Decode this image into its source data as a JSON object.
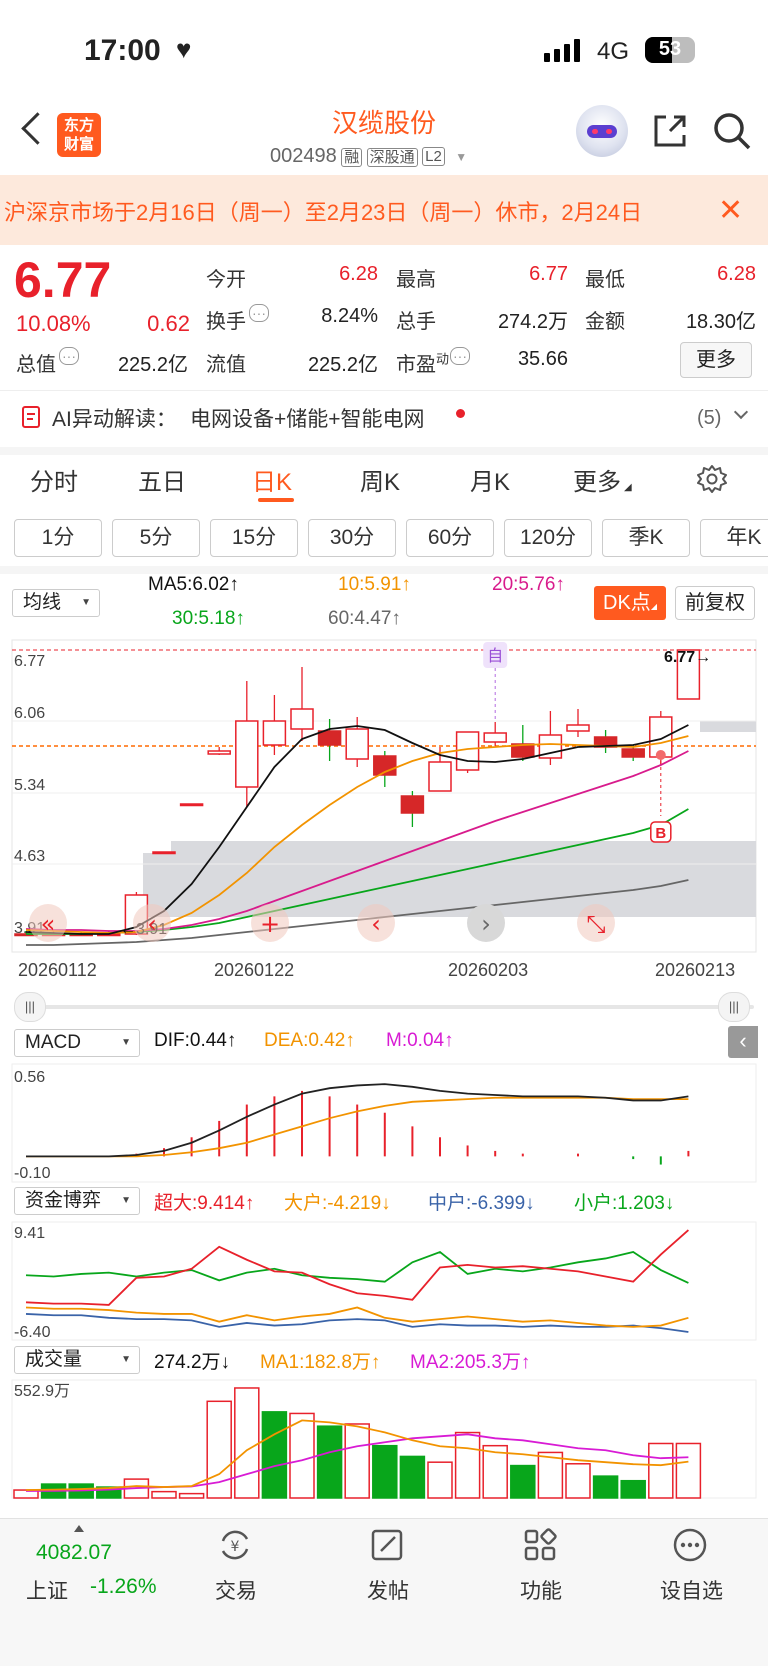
{
  "status_bar": {
    "time": "17:00",
    "network": "4G",
    "battery": "53"
  },
  "header": {
    "logo_line1": "东方",
    "logo_line2": "财富",
    "stock_name": "汉缆股份",
    "stock_code": "002498",
    "tags": [
      "融",
      "深股通",
      "L2"
    ]
  },
  "notice": {
    "text": "沪深京市场于2月16日（周一）至2月23日（周一）休市，2月24日"
  },
  "quote": {
    "price": "6.77",
    "change_pct": "10.08%",
    "change_amt": "0.62",
    "open_label": "今开",
    "open": "6.28",
    "high_label": "最高",
    "high": "6.77",
    "low_label": "最低",
    "low": "6.28",
    "turnover_label": "换手",
    "turnover": "8.24%",
    "volume_label": "总手",
    "volume": "274.2万",
    "amount_label": "金额",
    "amount": "18.30亿",
    "mktcap_label": "总值",
    "mktcap": "225.2亿",
    "float_label": "流值",
    "float": "225.2亿",
    "pe_label": "市盈",
    "pe_sup": "动",
    "pe": "35.66",
    "more": "更多"
  },
  "ai": {
    "label": "AI异动解读：",
    "text": "电网设备+储能+智能电网",
    "count": "(5)"
  },
  "tabs": [
    "分时",
    "五日",
    "日K",
    "周K",
    "月K",
    "更多"
  ],
  "active_tab": "日K",
  "periods": [
    "1分",
    "5分",
    "15分",
    "30分",
    "60分",
    "120分",
    "季K",
    "年K"
  ],
  "ma": {
    "selector": "均线",
    "ma5": "MA5:6.02↑",
    "ma10": "10:5.91↑",
    "ma20": "20:5.76↑",
    "ma30": "30:5.18↑",
    "ma60": "60:4.47↑",
    "dk": "DK点",
    "fq": "前复权"
  },
  "kline": {
    "price_labels": [
      "6.77",
      "6.06",
      "5.34",
      "4.63",
      "3.91"
    ],
    "dates": [
      "20260112",
      "20260122",
      "20260203",
      "20260213"
    ],
    "max_label": "6.77→",
    "min_label": "←3.91",
    "mark_self": "自",
    "mark_b": "B",
    "candles": [
      {
        "o": 3.93,
        "c": 3.92,
        "h": 3.96,
        "l": 3.91
      },
      {
        "o": 3.92,
        "c": 3.93,
        "h": 3.97,
        "l": 3.91
      },
      {
        "o": 3.93,
        "c": 3.92,
        "h": 3.95,
        "l": 3.91
      },
      {
        "o": 3.92,
        "c": 3.93,
        "h": 3.96,
        "l": 3.91
      },
      {
        "o": 3.93,
        "c": 4.32,
        "h": 4.35,
        "l": 3.92
      },
      {
        "o": 4.74,
        "c": 4.75,
        "h": 4.75,
        "l": 4.74
      },
      {
        "o": 5.22,
        "c": 5.23,
        "h": 5.23,
        "l": 5.22
      },
      {
        "o": 5.73,
        "c": 5.76,
        "h": 5.8,
        "l": 5.72
      },
      {
        "o": 5.4,
        "c": 6.06,
        "h": 6.46,
        "l": 5.2
      },
      {
        "o": 5.82,
        "c": 6.06,
        "h": 6.32,
        "l": 5.72
      },
      {
        "o": 5.98,
        "c": 6.18,
        "h": 6.6,
        "l": 5.86
      },
      {
        "o": 5.96,
        "c": 5.82,
        "h": 6.08,
        "l": 5.66
      },
      {
        "o": 5.68,
        "c": 5.98,
        "h": 6.1,
        "l": 5.6
      },
      {
        "o": 5.71,
        "c": 5.52,
        "h": 5.76,
        "l": 5.4
      },
      {
        "o": 5.31,
        "c": 5.14,
        "h": 5.36,
        "l": 5.0
      },
      {
        "o": 5.36,
        "c": 5.65,
        "h": 5.8,
        "l": 5.36
      },
      {
        "o": 5.57,
        "c": 5.95,
        "h": 5.95,
        "l": 5.54
      },
      {
        "o": 5.85,
        "c": 5.94,
        "h": 6.05,
        "l": 5.81
      },
      {
        "o": 5.83,
        "c": 5.7,
        "h": 6.02,
        "l": 5.66
      },
      {
        "o": 5.69,
        "c": 5.92,
        "h": 6.16,
        "l": 5.62
      },
      {
        "o": 5.96,
        "c": 6.02,
        "h": 6.18,
        "l": 5.9
      },
      {
        "o": 5.9,
        "c": 5.8,
        "h": 5.97,
        "l": 5.74
      },
      {
        "o": 5.78,
        "c": 5.7,
        "h": 5.82,
        "l": 5.66
      },
      {
        "o": 5.7,
        "c": 6.1,
        "h": 6.16,
        "l": 5.62
      },
      {
        "o": 6.28,
        "c": 6.77,
        "h": 6.77,
        "l": 6.28
      }
    ],
    "ma5": [
      3.95,
      3.94,
      3.93,
      3.93,
      4.0,
      4.16,
      4.43,
      4.8,
      5.2,
      5.6,
      5.88,
      5.98,
      6.01,
      5.97,
      5.84,
      5.72,
      5.66,
      5.65,
      5.68,
      5.74,
      5.8,
      5.81,
      5.82,
      5.88,
      6.02
    ],
    "ma10": [
      3.97,
      3.96,
      3.95,
      3.94,
      3.95,
      4.02,
      4.14,
      4.32,
      4.54,
      4.8,
      5.02,
      5.22,
      5.4,
      5.55,
      5.66,
      5.74,
      5.78,
      5.8,
      5.82,
      5.83,
      5.82,
      5.81,
      5.8,
      5.84,
      5.91
    ],
    "ma20": [
      3.98,
      3.97,
      3.97,
      3.96,
      3.96,
      3.98,
      4.02,
      4.08,
      4.16,
      4.26,
      4.36,
      4.46,
      4.56,
      4.66,
      4.76,
      4.86,
      4.96,
      5.06,
      5.15,
      5.24,
      5.33,
      5.42,
      5.51,
      5.62,
      5.76
    ],
    "ma30": [
      3.93,
      3.93,
      3.93,
      3.94,
      3.95,
      3.97,
      4.0,
      4.04,
      4.1,
      4.16,
      4.22,
      4.28,
      4.34,
      4.4,
      4.46,
      4.52,
      4.58,
      4.64,
      4.7,
      4.76,
      4.82,
      4.88,
      4.94,
      5.02,
      5.18
    ],
    "ma60": [
      3.82,
      3.82,
      3.83,
      3.84,
      3.85,
      3.87,
      3.89,
      3.92,
      3.95,
      3.98,
      4.01,
      4.04,
      4.07,
      4.1,
      4.13,
      4.16,
      4.19,
      4.22,
      4.25,
      4.28,
      4.31,
      4.34,
      4.37,
      4.41,
      4.47
    ]
  },
  "macd": {
    "selector": "MACD",
    "dif": "DIF:0.44↑",
    "dea": "DEA:0.42↑",
    "m": "M:0.04↑",
    "top": "0.56",
    "bottom": "-0.10",
    "dif_series": [
      0.0,
      0.0,
      0.0,
      0.0,
      0.01,
      0.04,
      0.1,
      0.19,
      0.29,
      0.38,
      0.46,
      0.5,
      0.52,
      0.53,
      0.51,
      0.48,
      0.46,
      0.45,
      0.44,
      0.44,
      0.44,
      0.43,
      0.41,
      0.41,
      0.44
    ],
    "dea_series": [
      0.0,
      0.0,
      0.0,
      0.0,
      0.0,
      0.01,
      0.03,
      0.06,
      0.1,
      0.16,
      0.22,
      0.28,
      0.33,
      0.37,
      0.4,
      0.41,
      0.42,
      0.43,
      0.43,
      0.43,
      0.43,
      0.43,
      0.42,
      0.42,
      0.42
    ],
    "bars": [
      0.0,
      0.0,
      0.0,
      0.0,
      0.02,
      0.06,
      0.14,
      0.26,
      0.38,
      0.44,
      0.48,
      0.44,
      0.38,
      0.32,
      0.22,
      0.14,
      0.08,
      0.04,
      0.02,
      0.0,
      0.02,
      0.0,
      -0.02,
      -0.06,
      0.04
    ]
  },
  "funds": {
    "selector": "资金博弈",
    "super": "超大:9.414↑",
    "big": "大户:-4.219↓",
    "mid": "中户:-6.399↓",
    "small": "小户:1.203↓",
    "top": "9.41",
    "bottom": "-6.40",
    "super_series": [
      -1.8,
      -2.0,
      -2.0,
      -2.2,
      2.0,
      2.2,
      3.4,
      6.8,
      4.8,
      3.0,
      2.8,
      1.0,
      -0.4,
      -0.8,
      -1.4,
      3.6,
      4.0,
      3.6,
      3.8,
      3.4,
      3.0,
      2.2,
      1.4,
      5.6,
      9.4
    ],
    "big_series": [
      -2.6,
      -2.8,
      -2.8,
      -3.0,
      -3.4,
      -3.6,
      -3.6,
      -4.8,
      -3.8,
      -4.6,
      -4.0,
      -3.6,
      -2.6,
      -4.2,
      -4.8,
      -4.4,
      -4.0,
      -4.4,
      -4.8,
      -4.6,
      -5.0,
      -5.4,
      -5.6,
      -5.4,
      -4.2
    ],
    "mid_series": [
      -3.6,
      -3.8,
      -3.8,
      -4.2,
      -4.4,
      -4.4,
      -4.6,
      -5.6,
      -5.0,
      -5.4,
      -5.2,
      -4.6,
      -4.4,
      -4.6,
      -5.6,
      -5.2,
      -5.4,
      -5.4,
      -5.6,
      -5.4,
      -5.6,
      -5.6,
      -5.4,
      -5.8,
      -6.4
    ],
    "small_series": [
      2.4,
      2.2,
      2.6,
      2.8,
      2.2,
      2.8,
      3.2,
      1.6,
      2.8,
      3.4,
      2.4,
      2.0,
      1.8,
      1.4,
      4.4,
      6.0,
      2.6,
      3.4,
      3.0,
      3.6,
      4.4,
      5.0,
      6.0,
      3.2,
      1.2
    ]
  },
  "volume": {
    "selector": "成交量",
    "value": "274.2万↓",
    "ma1": "MA1:182.8万↑",
    "ma2": "MA2:205.3万↑",
    "top": "552.9万",
    "bars": [
      {
        "v": 40,
        "up": true
      },
      {
        "v": 70,
        "up": false
      },
      {
        "v": 70,
        "up": false
      },
      {
        "v": 55,
        "up": false
      },
      {
        "v": 95,
        "up": true
      },
      {
        "v": 32,
        "up": true
      },
      {
        "v": 22,
        "up": true
      },
      {
        "v": 486,
        "up": true
      },
      {
        "v": 553,
        "up": true
      },
      {
        "v": 433,
        "up": false
      },
      {
        "v": 425,
        "up": true
      },
      {
        "v": 361,
        "up": false
      },
      {
        "v": 372,
        "up": true
      },
      {
        "v": 263,
        "up": false
      },
      {
        "v": 209,
        "up": false
      },
      {
        "v": 180,
        "up": true
      },
      {
        "v": 329,
        "up": true
      },
      {
        "v": 263,
        "up": true
      },
      {
        "v": 163,
        "up": false
      },
      {
        "v": 229,
        "up": true
      },
      {
        "v": 172,
        "up": true
      },
      {
        "v": 110,
        "up": false
      },
      {
        "v": 87,
        "up": false
      },
      {
        "v": 274,
        "up": true
      },
      {
        "v": 274,
        "up": true
      }
    ],
    "ma1_series": [
      40,
      42,
      45,
      50,
      60,
      55,
      60,
      120,
      240,
      320,
      390,
      380,
      360,
      330,
      290,
      260,
      250,
      230,
      220,
      205,
      190,
      180,
      170,
      165,
      183
    ],
    "ma2_series": [
      35,
      36,
      38,
      42,
      50,
      55,
      58,
      80,
      120,
      160,
      190,
      230,
      260,
      280,
      300,
      310,
      320,
      300,
      290,
      270,
      250,
      240,
      215,
      200,
      205
    ]
  },
  "bottom_nav": {
    "index_value": "4082.07",
    "index_name": "上证",
    "index_change": "-1.26%",
    "items": [
      "交易",
      "发帖",
      "功能",
      "设自选"
    ]
  },
  "colors": {
    "up": "#e8212b",
    "down": "#08a61b",
    "accent": "#ff6a00",
    "ma5": "#111111",
    "ma10": "#f29300",
    "ma20": "#d81b8c",
    "ma30": "#08a61b",
    "ma60": "#666666"
  }
}
